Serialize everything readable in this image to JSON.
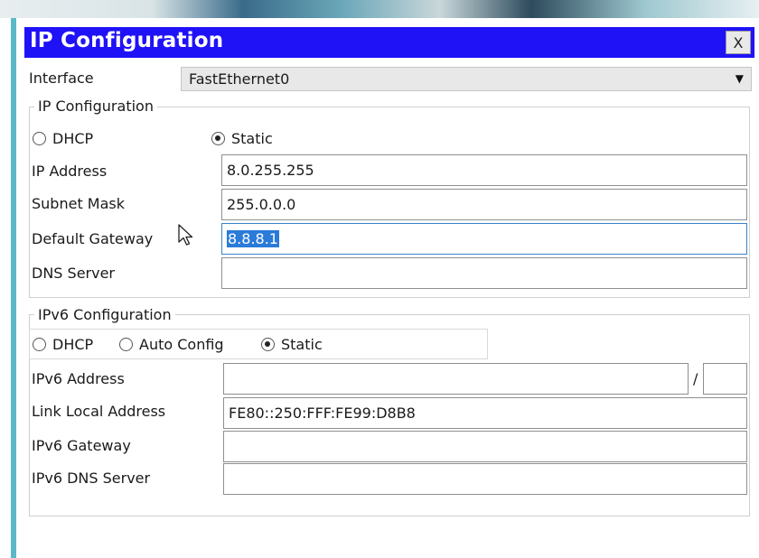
{
  "window": {
    "title": "IP Configuration",
    "close_label": "X"
  },
  "interface": {
    "label": "Interface",
    "value": "FastEthernet0",
    "arrow_icon": "chevron-down-icon"
  },
  "ipv4": {
    "group_title": "IP Configuration",
    "dhcp_label": "DHCP",
    "static_label": "Static",
    "selected_mode": "Static",
    "ip_address_label": "IP Address",
    "ip_address_value": "8.0.255.255",
    "subnet_mask_label": "Subnet Mask",
    "subnet_mask_value": "255.0.0.0",
    "default_gateway_label": "Default Gateway",
    "default_gateway_value": "8.8.8.1",
    "dns_server_label": "DNS Server",
    "dns_server_value": ""
  },
  "ipv6": {
    "group_title": "IPv6 Configuration",
    "dhcp_label": "DHCP",
    "auto_config_label": "Auto Config",
    "static_label": "Static",
    "selected_mode": "Static",
    "address_label": "IPv6 Address",
    "address_value": "",
    "prefix_separator": "/",
    "prefix_value": "",
    "link_local_label": "Link Local Address",
    "link_local_value": "FE80::250:FFF:FE99:D8B8",
    "gateway_label": "IPv6 Gateway",
    "gateway_value": "",
    "dns_server_label": "IPv6 DNS Server",
    "dns_server_value": ""
  },
  "colors": {
    "titlebar": "#1f12f7",
    "selection": "#2b7bd8"
  }
}
